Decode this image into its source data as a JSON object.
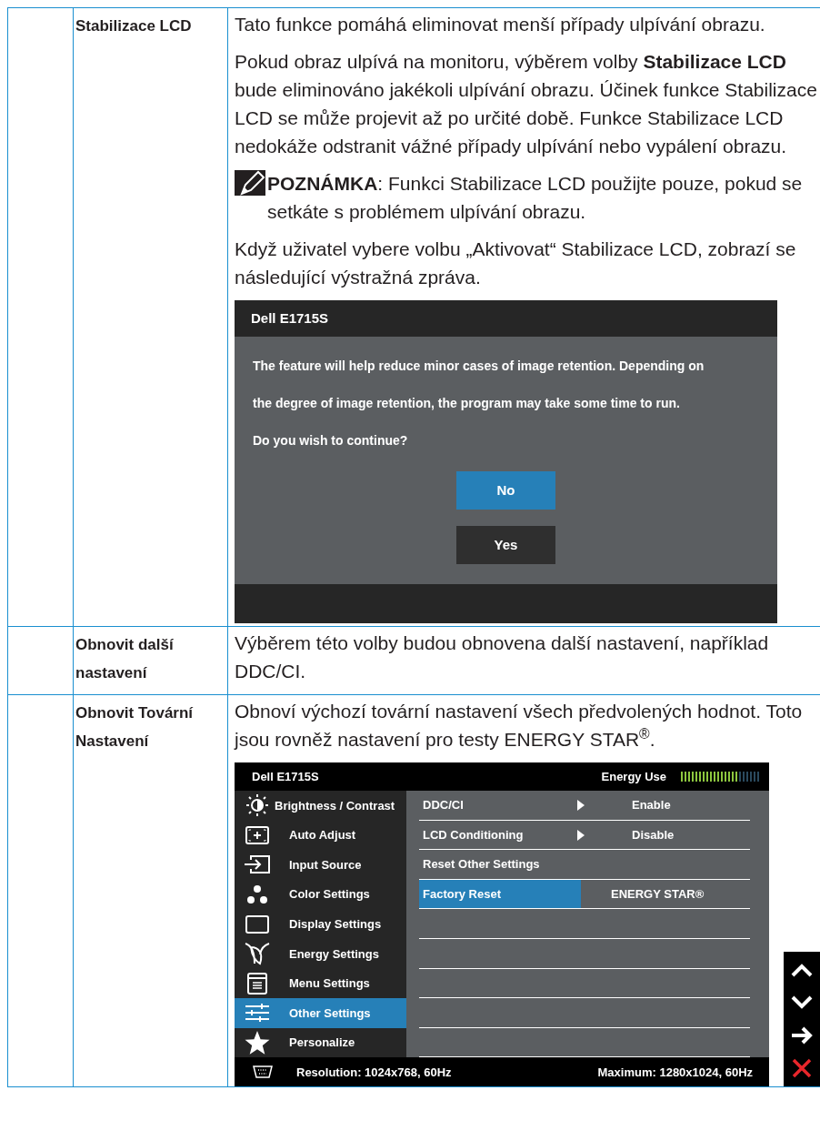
{
  "rows": [
    {
      "label": "Stabilizace LCD",
      "content": [
        {
          "kind": "paragraph",
          "text": "Tato funkce pomáhá eliminovat menší případy ulpívání obrazu."
        },
        {
          "kind": "paragraph",
          "text": "Pokud obraz ulpívá na monitoru, výběrem volby **Stabilizace LCD** bude eliminováno jakékoli ulpívání obrazu. Účinek funkce Stabilizace LCD se může projevit až po určité době. Funkce Stabilizace LCD nedokáže odstranit vážné případy ulpívání nebo vypálení obrazu."
        },
        {
          "kind": "note",
          "text": "**POZNÁMKA**: Funkci Stabilizace LCD použijte pouze, pokud se setkáte s problémem ulpívání obrazu."
        },
        {
          "kind": "paragraph",
          "text": "Když uživatel vybere volbu „Aktivovat“ Stabilizace LCD, zobrazí se následující výstražná zpráva."
        },
        {
          "kind": "dialog",
          "title": "Dell E1715S",
          "message": [
            "The feature will help reduce minor cases of image retention. Depending on",
            "the degree of image retention, the program may take some time to run.",
            "Do you wish to continue?"
          ],
          "buttons": [
            {
              "label": "No",
              "selected": true
            },
            {
              "label": "Yes",
              "selected": false
            }
          ]
        }
      ]
    },
    {
      "label": "Obnovit další nastavení",
      "content": [
        {
          "kind": "paragraph",
          "text": "Výběrem této volby budou obnovena další nastavení, například DDC/CI."
        }
      ]
    },
    {
      "label": "Obnovit Tovární Nastavení",
      "content": [
        {
          "kind": "paragraph",
          "text": "Obnoví výchozí tovární nastavení všech předvolených hodnot. Toto jsou rovněž nastavení pro testy ENERGY STAR$^{®}$."
        },
        {
          "kind": "osd",
          "title": "Dell E1715S",
          "energy": {
            "label": "Energy Use",
            "level": 0.73
          },
          "menu": [
            {
              "label": "Brightness / Contrast",
              "selected": false
            },
            {
              "label": "Auto Adjust",
              "selected": false
            },
            {
              "label": "Input Source",
              "selected": false
            },
            {
              "label": "Color Settings",
              "selected": false
            },
            {
              "label": "Display Settings",
              "selected": false
            },
            {
              "label": "Energy Settings",
              "selected": false
            },
            {
              "label": "Menu Settings",
              "selected": false
            },
            {
              "label": "Other Settings",
              "selected": true
            },
            {
              "label": "Personalize",
              "selected": false
            }
          ],
          "options": [
            {
              "label": "DDC/CI",
              "value": "Enable",
              "submenu": true,
              "selected": false
            },
            {
              "label": "LCD Conditioning",
              "value": "Disable",
              "submenu": true,
              "selected": false
            },
            {
              "label": "Reset Other Settings",
              "submenu": false,
              "selected": false
            },
            {
              "label": "Factory Reset",
              "value": "ENERGY STAR®",
              "submenu": false,
              "selected": true
            }
          ],
          "resolution": "Resolution: 1024x768, 60Hz",
          "maximum": "Maximum: 1280x1024, 60Hz"
        }
      ]
    }
  ]
}
